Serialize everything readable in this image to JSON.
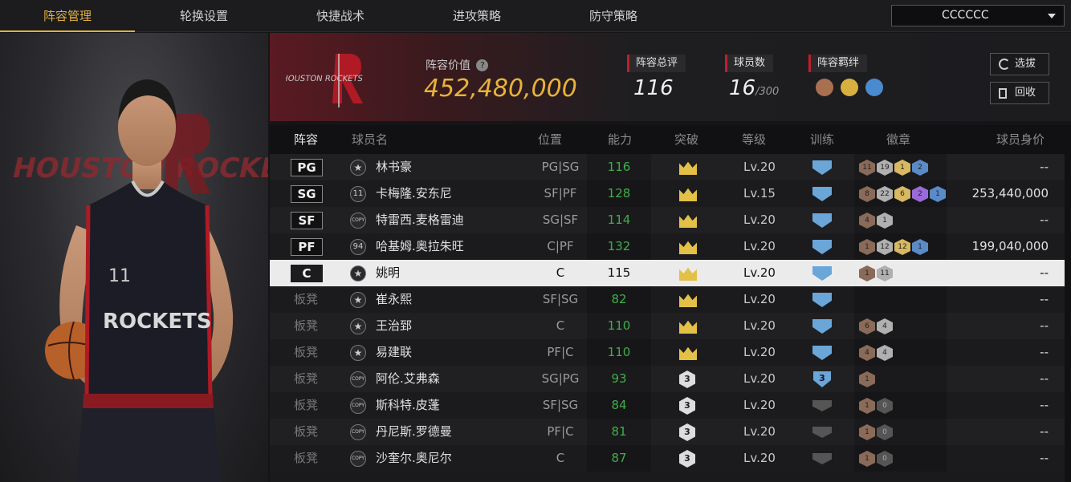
{
  "nav": {
    "tabs": [
      "阵容管理",
      "轮换设置",
      "快捷战术",
      "进攻策略",
      "防守策略"
    ],
    "active_index": 0,
    "team_select": "CCCCCC"
  },
  "portrait": {
    "jersey_text": "ROCKETS",
    "jersey_number": "11",
    "backdrop_text": "HOUSTON ROCKETS"
  },
  "banner": {
    "logo_text": "HOUSTON ROCKETS",
    "value_label": "阵容价值",
    "value": "452,480,000",
    "rating_label": "阵容总评",
    "rating": "116",
    "players_label": "球员数",
    "players": "16",
    "players_max": "/300",
    "bond_label": "阵容羁绊",
    "select_btn": "选拔",
    "recycle_btn": "回收"
  },
  "table": {
    "headers": {
      "lineup": "阵容",
      "name": "球员名",
      "position": "位置",
      "ability": "能力",
      "breakthrough": "突破",
      "level": "等级",
      "training": "训练",
      "badges": "徽章",
      "value": "球员身价"
    },
    "rows": [
      {
        "slot": "PG",
        "bench": false,
        "icon": "star",
        "icon_text": "",
        "name": "林书豪",
        "position": "PG|SG",
        "ability": "116",
        "break": "crown",
        "level": "Lv.20",
        "train": "crown",
        "badges": [
          {
            "t": "11",
            "c": "#8a6a58"
          },
          {
            "t": "19",
            "c": "#b0b0b0"
          },
          {
            "t": "1",
            "c": "#d8b860"
          },
          {
            "t": "2",
            "c": "#5a8ac8"
          }
        ],
        "value": "--"
      },
      {
        "slot": "SG",
        "bench": false,
        "icon": "number",
        "icon_text": "11",
        "name": "卡梅隆.安东尼",
        "position": "SF|PF",
        "ability": "128",
        "break": "crown",
        "level": "Lv.15",
        "train": "crown",
        "badges": [
          {
            "t": "8",
            "c": "#8a6a58"
          },
          {
            "t": "22",
            "c": "#b0b0b0"
          },
          {
            "t": "6",
            "c": "#d8b860"
          },
          {
            "t": "2",
            "c": "#9a6ad8"
          },
          {
            "t": "1",
            "c": "#5a8ac8"
          }
        ],
        "value": "253,440,000"
      },
      {
        "slot": "SF",
        "bench": false,
        "icon": "copy",
        "icon_text": "COPY",
        "name": "特雷西.麦格雷迪",
        "position": "SG|SF",
        "ability": "114",
        "break": "crown",
        "level": "Lv.20",
        "train": "crown",
        "badges": [
          {
            "t": "4",
            "c": "#8a6a58"
          },
          {
            "t": "1",
            "c": "#b0b0b0"
          }
        ],
        "value": "--"
      },
      {
        "slot": "PF",
        "bench": false,
        "icon": "number",
        "icon_text": "94",
        "name": "哈基姆.奥拉朱旺",
        "position": "C|PF",
        "ability": "132",
        "break": "crown",
        "level": "Lv.20",
        "train": "crown",
        "badges": [
          {
            "t": "1",
            "c": "#8a6a58"
          },
          {
            "t": "12",
            "c": "#b0b0b0"
          },
          {
            "t": "12",
            "c": "#d8b860"
          },
          {
            "t": "1",
            "c": "#5a8ac8"
          }
        ],
        "value": "199,040,000"
      },
      {
        "slot": "C",
        "bench": false,
        "icon": "star",
        "icon_text": "",
        "name": "姚明",
        "position": "C",
        "ability": "115",
        "break": "crown",
        "level": "Lv.20",
        "train": "crown",
        "badges": [
          {
            "t": "1",
            "c": "#8a6a58"
          },
          {
            "t": "11",
            "c": "#b0b0b0"
          }
        ],
        "value": "--",
        "selected": true
      },
      {
        "slot": "板凳",
        "bench": true,
        "icon": "star",
        "icon_text": "",
        "name": "崔永熙",
        "position": "SF|SG",
        "ability": "82",
        "break": "crown",
        "level": "Lv.20",
        "train": "crown",
        "badges": [],
        "value": "--"
      },
      {
        "slot": "板凳",
        "bench": true,
        "icon": "star",
        "icon_text": "",
        "name": "王治郅",
        "position": "C",
        "ability": "110",
        "break": "crown",
        "level": "Lv.20",
        "train": "crown",
        "badges": [
          {
            "t": "6",
            "c": "#8a6a58"
          },
          {
            "t": "4",
            "c": "#b0b0b0"
          }
        ],
        "value": "--"
      },
      {
        "slot": "板凳",
        "bench": true,
        "icon": "star",
        "icon_text": "",
        "name": "易建联",
        "position": "PF|C",
        "ability": "110",
        "break": "crown",
        "level": "Lv.20",
        "train": "crown",
        "badges": [
          {
            "t": "4",
            "c": "#8a6a58"
          },
          {
            "t": "4",
            "c": "#b0b0b0"
          }
        ],
        "value": "--"
      },
      {
        "slot": "板凳",
        "bench": true,
        "icon": "copy",
        "icon_text": "COPY",
        "name": "阿伦.艾弗森",
        "position": "SG|PG",
        "ability": "93",
        "break": "3",
        "level": "Lv.20",
        "train": "3",
        "badges": [
          {
            "t": "1",
            "c": "#8a6a58"
          }
        ],
        "value": "--"
      },
      {
        "slot": "板凳",
        "bench": true,
        "icon": "copy",
        "icon_text": "COPY",
        "name": "斯科特.皮蓬",
        "position": "SF|SG",
        "ability": "84",
        "break": "3",
        "level": "Lv.20",
        "train": "empty",
        "badges": [
          {
            "t": "1",
            "c": "#8a6a58"
          },
          {
            "t": "0",
            "c": "#555555"
          }
        ],
        "value": "--"
      },
      {
        "slot": "板凳",
        "bench": true,
        "icon": "copy",
        "icon_text": "COPY",
        "name": "丹尼斯.罗德曼",
        "position": "PF|C",
        "ability": "81",
        "break": "3",
        "level": "Lv.20",
        "train": "empty",
        "badges": [
          {
            "t": "1",
            "c": "#8a6a58"
          },
          {
            "t": "0",
            "c": "#555555"
          }
        ],
        "value": "--"
      },
      {
        "slot": "板凳",
        "bench": true,
        "icon": "copy",
        "icon_text": "COPY",
        "name": "沙奎尔.奥尼尔",
        "position": "C",
        "ability": "87",
        "break": "3",
        "level": "Lv.20",
        "train": "empty",
        "badges": [
          {
            "t": "1",
            "c": "#8a6a58"
          },
          {
            "t": "0",
            "c": "#555555"
          }
        ],
        "value": "--"
      }
    ]
  },
  "colors": {
    "accent": "#e0b040",
    "ability_green": "#3fae4a",
    "team_red": "#c01f2a"
  }
}
